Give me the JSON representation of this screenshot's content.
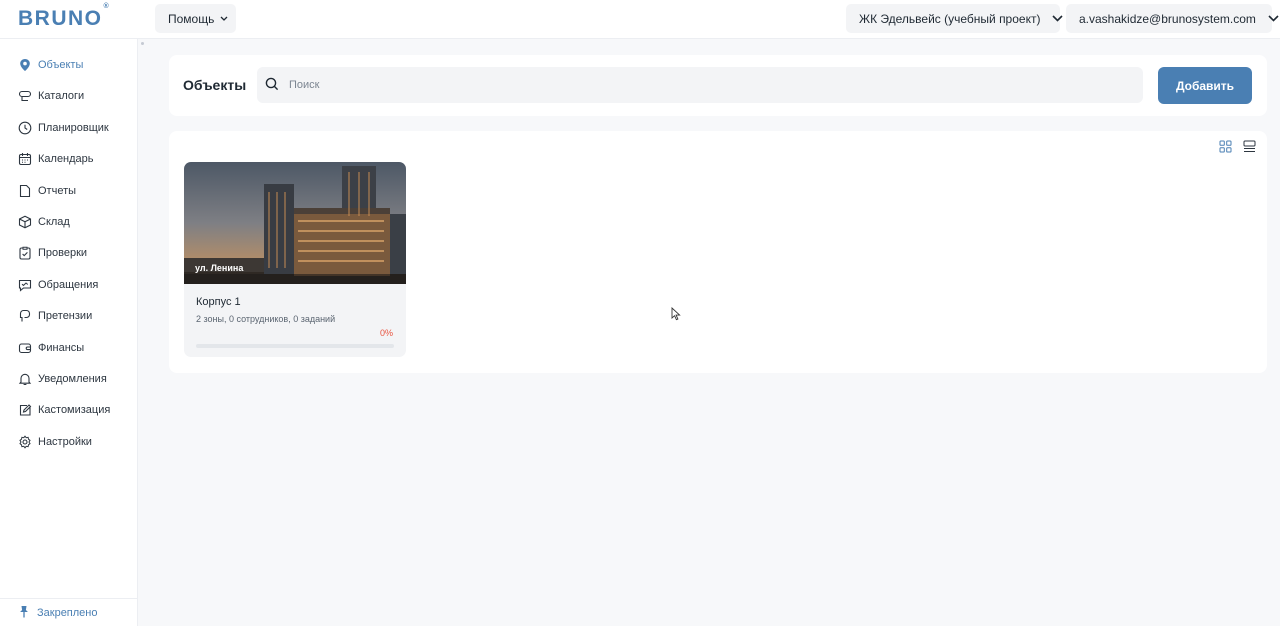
{
  "header": {
    "logo": "BRUNO",
    "logo_mark": "®",
    "help_label": "Помощь",
    "project_label": "ЖК Эдельвейс (учебный проект)",
    "user_label": "a.vashakidze@brunosystem.com"
  },
  "sidebar": {
    "items": [
      {
        "label": "Объекты",
        "icon": "map-pin-icon",
        "active": true
      },
      {
        "label": "Каталоги",
        "icon": "catalog-icon"
      },
      {
        "label": "Планировщик",
        "icon": "clock-icon"
      },
      {
        "label": "Календарь",
        "icon": "calendar-icon"
      },
      {
        "label": "Отчеты",
        "icon": "report-icon"
      },
      {
        "label": "Склад",
        "icon": "box-icon"
      },
      {
        "label": "Проверки",
        "icon": "checklist-icon"
      },
      {
        "label": "Обращения",
        "icon": "message-icon"
      },
      {
        "label": "Претензии",
        "icon": "complaint-icon"
      },
      {
        "label": "Финансы",
        "icon": "wallet-icon"
      },
      {
        "label": "Уведомления",
        "icon": "bell-icon"
      },
      {
        "label": "Кастомизация",
        "icon": "edit-icon"
      },
      {
        "label": "Настройки",
        "icon": "gear-icon"
      }
    ],
    "pinned_label": "Закреплено"
  },
  "main": {
    "title": "Объекты",
    "search_placeholder": "Поиск",
    "add_label": "Добавить",
    "objects": [
      {
        "address": "ул. Ленина",
        "name": "Корпус 1",
        "meta": "2 зоны, 0 сотрудников, 0 заданий",
        "progress_label": "0%",
        "progress": 0
      }
    ]
  },
  "colors": {
    "accent": "#4a7fb3",
    "progress": "#e8533f",
    "background": "#f7f8fa"
  }
}
